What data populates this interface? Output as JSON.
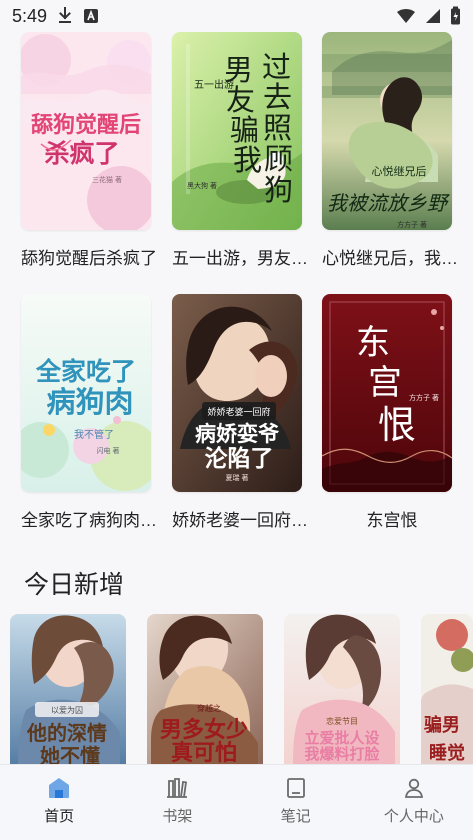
{
  "status_bar": {
    "time": "5:49",
    "download_icon": "download-icon",
    "app_icon": "a-icon",
    "wifi_icon": "wifi-icon",
    "signal_icon": "signal-icon",
    "battery_icon": "battery-icon"
  },
  "books": [
    {
      "title": "舔狗觉醒后杀疯了",
      "cover_title": "舔狗觉醒后杀疯了",
      "cover_author": "三花猫 著",
      "accent": "#e54d7e",
      "bg": "#fde7ef"
    },
    {
      "title": "五一出游，男友骗我过去照顾狗",
      "cover_title": "男友骗我过去照顾狗",
      "cover_author": "黑大狗 著",
      "cover_tag": "五一出游",
      "accent": "#1e2b1e",
      "bg": "#9ed069"
    },
    {
      "title": "心悦继兄后，我被流放乡野",
      "cover_title": "我被流放乡野",
      "cover_author": "方方子 著",
      "cover_tag": "心悦继兄后",
      "accent": "#17301a",
      "bg": "#cfe0a8"
    },
    {
      "title": "全家吃了病狗肉，我不管了",
      "cover_title": "全家吃了病狗肉",
      "cover_author": "闪电 著",
      "cover_tag": "我不管了",
      "accent": "#2f8eb5",
      "bg": "#edf6f6"
    },
    {
      "title": "娇娇老婆一回府，病娇娈爷沦陷了",
      "cover_title": "病娇娈爷沦陷了",
      "cover_author": "夏瑞 著",
      "cover_tag": "娇娇老婆一回府",
      "accent": "#ffffff",
      "bg": "#6b4c3b"
    },
    {
      "title": "东宫恨",
      "cover_title": "东宫恨",
      "cover_author": "方方子 著",
      "accent": "#ffffff",
      "bg": "#6d0b12"
    }
  ],
  "section": {
    "today_new": "今日新增"
  },
  "rail": [
    {
      "title": "他的深情她不懂",
      "tag": "以爱为囚",
      "accent": "#7d4c1f"
    },
    {
      "title": "男多女少真可怕",
      "tag": "穿越之",
      "accent": "#9c1c1c"
    },
    {
      "title": "我爆料打脸",
      "tag": "恋爱节目",
      "accent": "#e97ea4"
    },
    {
      "title": "骗男睡觉",
      "tag": "",
      "accent": "#9b1e1e"
    }
  ],
  "bottom_nav": [
    {
      "label": "首页",
      "icon": "home-icon",
      "active": true
    },
    {
      "label": "书架",
      "icon": "bookshelf-icon",
      "active": false
    },
    {
      "label": "笔记",
      "icon": "notes-icon",
      "active": false
    },
    {
      "label": "个人中心",
      "icon": "profile-icon",
      "active": false
    }
  ]
}
